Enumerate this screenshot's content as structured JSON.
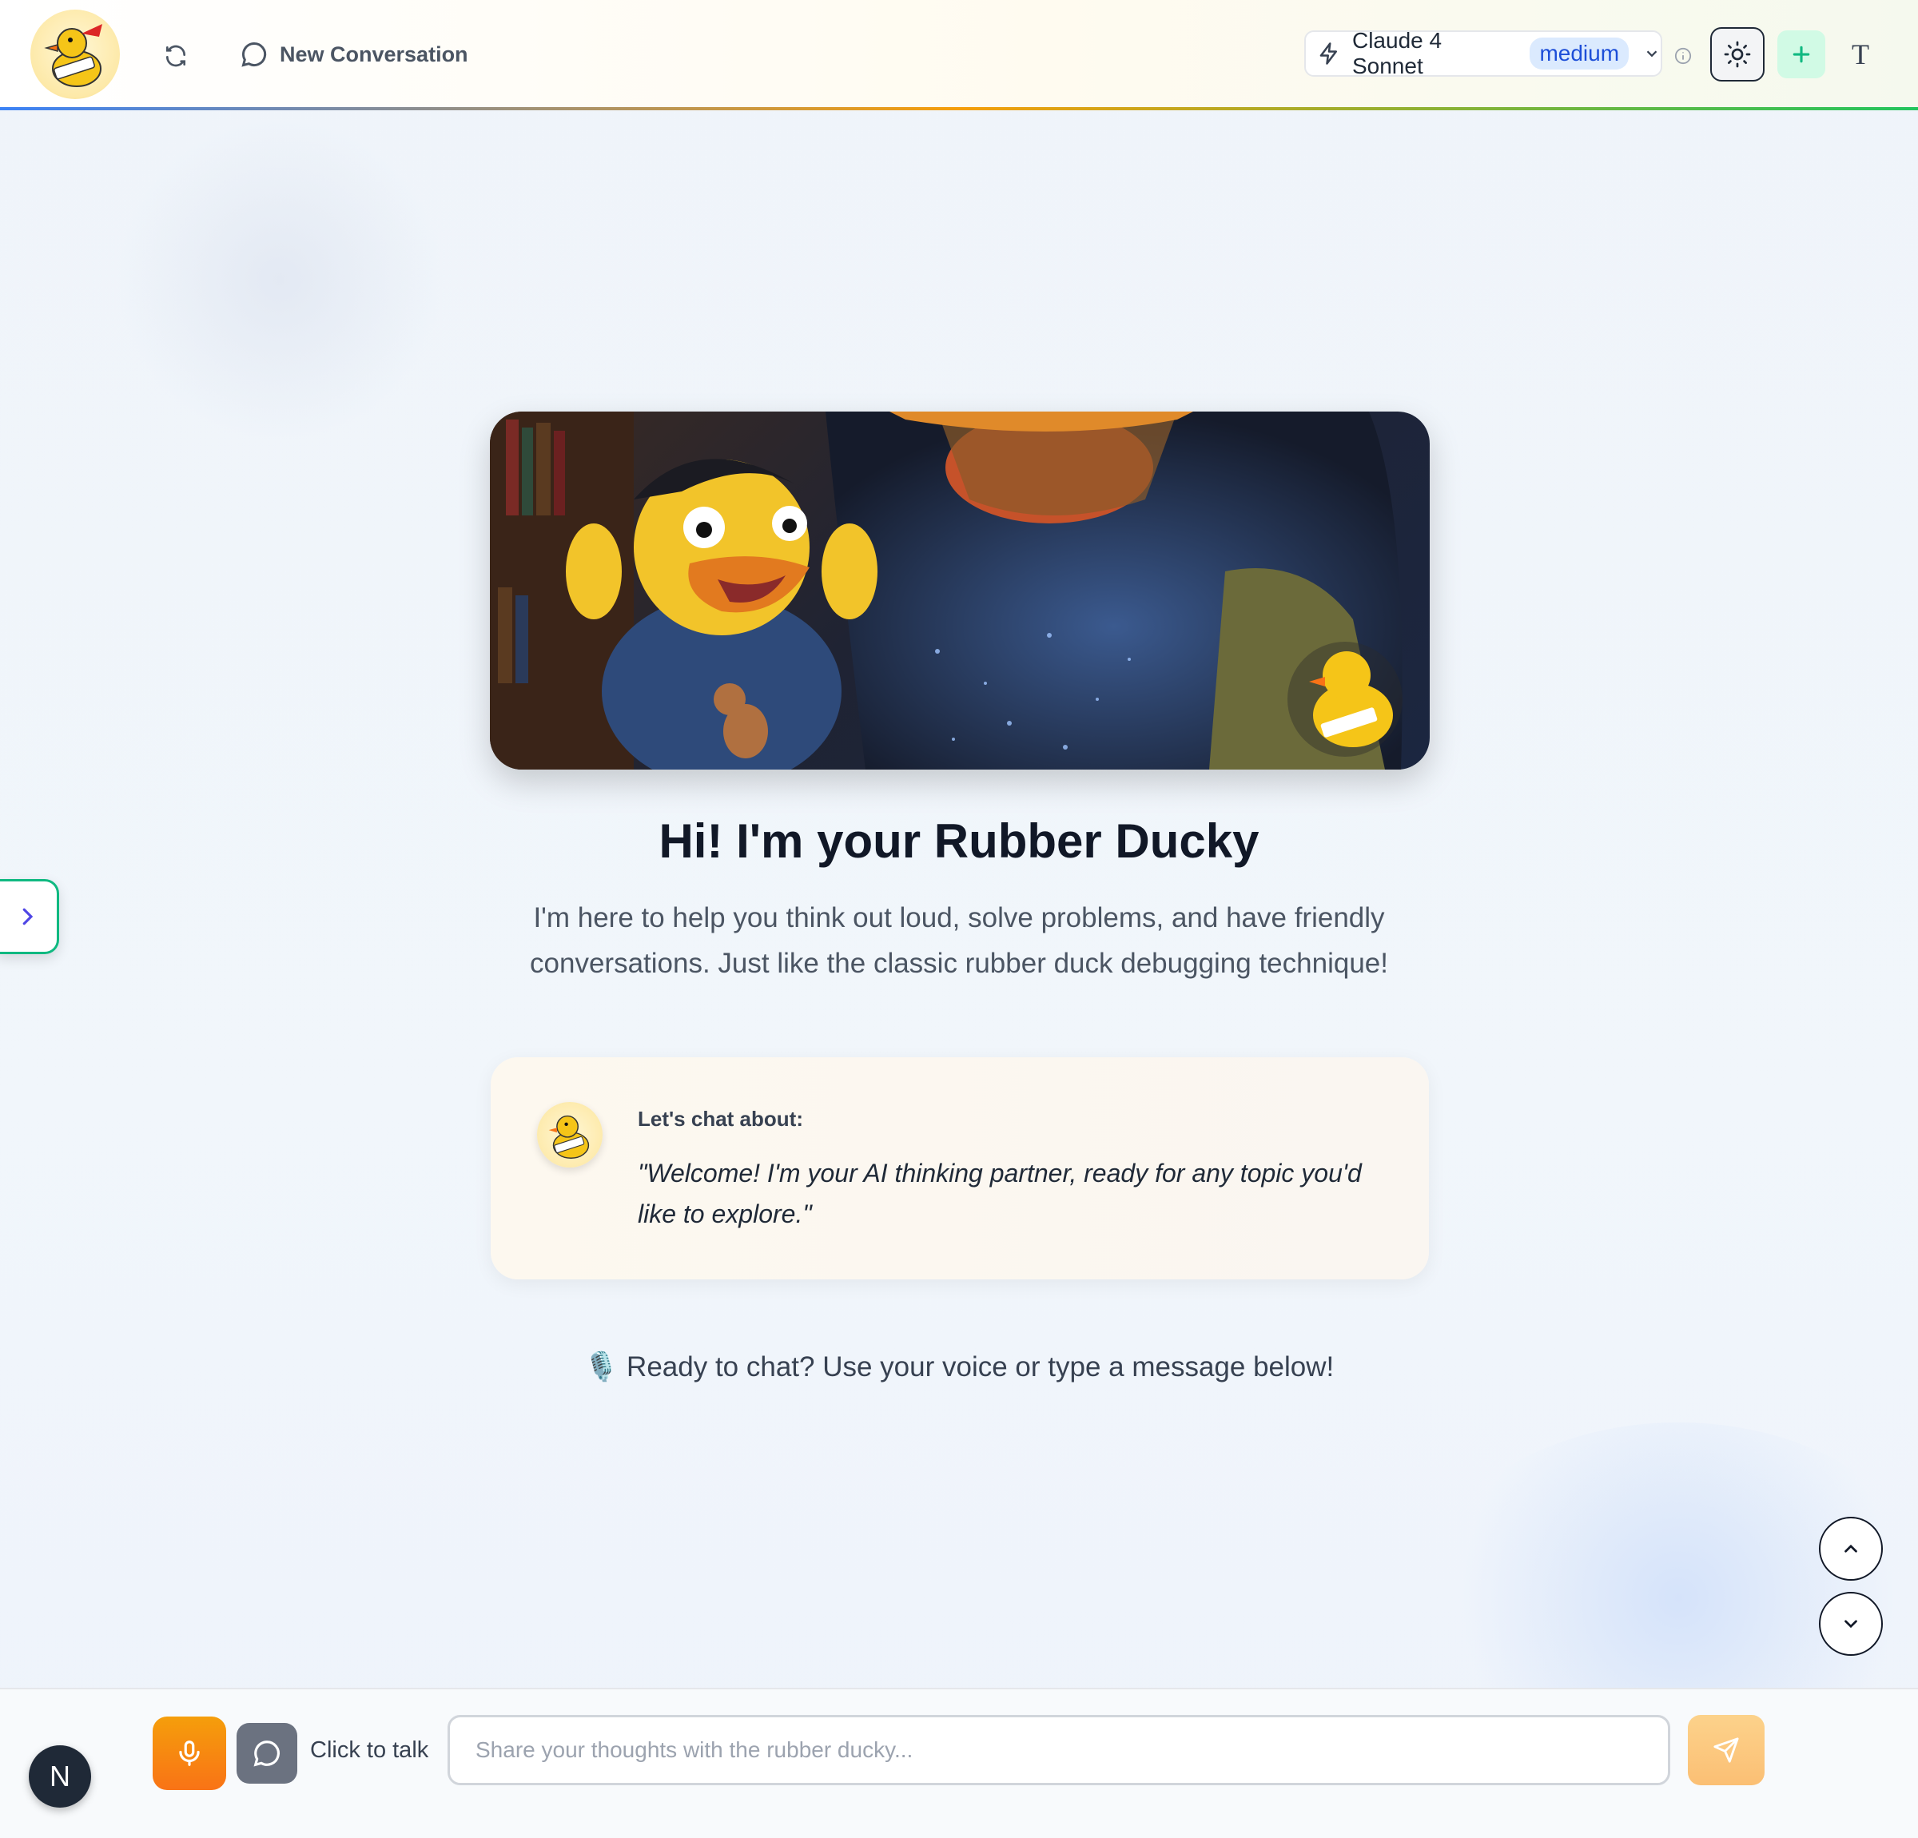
{
  "header": {
    "new_conversation_label": "New Conversation",
    "model": {
      "name": "Claude 4 Sonnet",
      "badge": "medium"
    },
    "text_size_label": "T"
  },
  "hero": {
    "title": "Hi! I'm your Rubber Ducky",
    "subtitle": "I'm here to help you think out loud, solve problems, and have friendly conversations. Just like the classic rubber duck debugging technique!"
  },
  "card": {
    "label": "Let's chat about:",
    "quote": "\"Welcome! I'm your AI thinking partner, ready for any topic you'd like to explore.\""
  },
  "ready_text": "🎙️ Ready to chat? Use your voice or type a message below!",
  "footer": {
    "avatar_initial": "N",
    "talk_label": "Click to talk",
    "input_placeholder": "Share your thoughts with the rubber ducky...",
    "input_value": ""
  },
  "icons": {
    "refresh": "refresh-icon",
    "chat": "chat-bubble-icon",
    "lightning": "lightning-icon",
    "chevron_down": "chevron-down-icon",
    "info": "info-icon",
    "sun": "sun-icon",
    "plus": "plus-icon",
    "microphone": "microphone-icon",
    "send": "send-icon"
  },
  "colors": {
    "accent_green": "#10b981",
    "badge_blue": "#1d4ed8",
    "mic_orange": "#f59e0b",
    "send_orange": "#fbbf74"
  }
}
